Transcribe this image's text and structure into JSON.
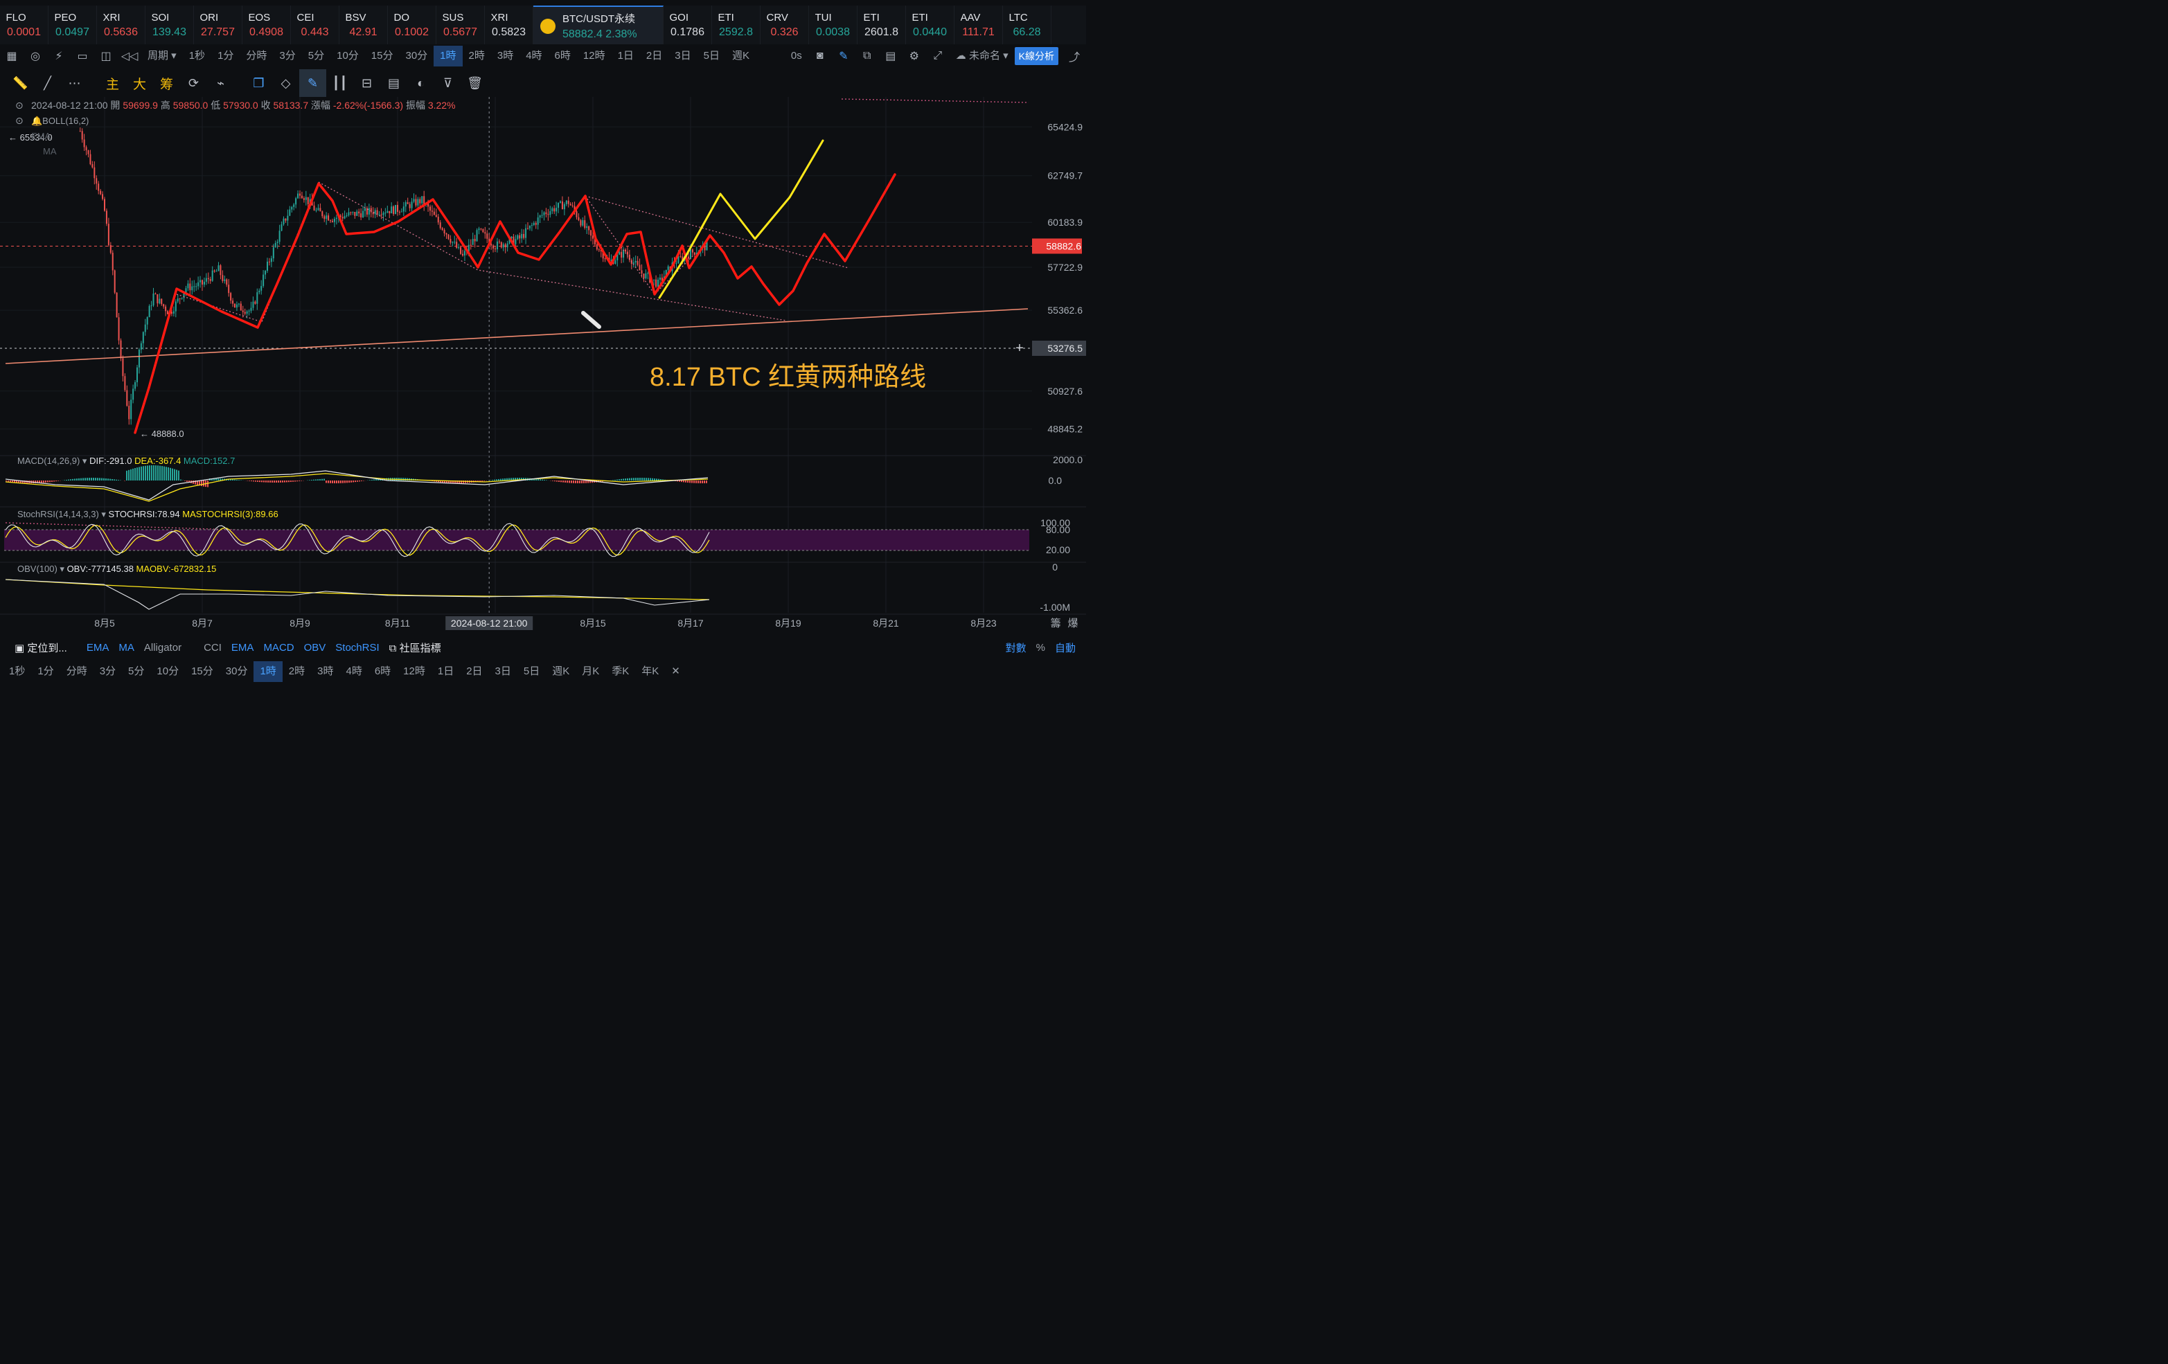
{
  "ticker": [
    {
      "sym": "FLO",
      "px": "0.0001",
      "dir": "down"
    },
    {
      "sym": "PEO",
      "px": "0.0497",
      "dir": "up"
    },
    {
      "sym": "XRI",
      "px": "0.5636",
      "dir": "down"
    },
    {
      "sym": "SOI",
      "px": "139.43",
      "dir": "up"
    },
    {
      "sym": "ORI",
      "px": "27.757",
      "dir": "down"
    },
    {
      "sym": "EOS",
      "px": "0.4908",
      "dir": "down"
    },
    {
      "sym": "CEI",
      "px": "0.443",
      "dir": "down"
    },
    {
      "sym": "BSV",
      "px": "42.91",
      "dir": "down"
    },
    {
      "sym": "DO",
      "px": "0.1002",
      "dir": "down"
    },
    {
      "sym": "SUS",
      "px": "0.5677",
      "dir": "down"
    },
    {
      "sym": "XRI",
      "px": "0.5823",
      "dir": "neutral"
    },
    {
      "sym": "BTC/USDT永续",
      "px": "58882.4  2.38%",
      "dir": "up",
      "active": true
    },
    {
      "sym": "GOI",
      "px": "0.1786",
      "dir": "neutral"
    },
    {
      "sym": "ETI",
      "px": "2592.8",
      "dir": "up"
    },
    {
      "sym": "CRV",
      "px": "0.326",
      "dir": "down"
    },
    {
      "sym": "TUI",
      "px": "0.0038",
      "dir": "up"
    },
    {
      "sym": "ETI",
      "px": "2601.8",
      "dir": "neutral"
    },
    {
      "sym": "ETI",
      "px": "0.0440",
      "dir": "up"
    },
    {
      "sym": "AAV",
      "px": "111.71",
      "dir": "down"
    },
    {
      "sym": "LTC",
      "px": "66.28",
      "dir": "up"
    }
  ],
  "periods": {
    "label": "周期",
    "items": [
      "1秒",
      "1分",
      "分時",
      "3分",
      "5分",
      "10分",
      "15分",
      "30分",
      "1時",
      "2時",
      "3時",
      "4時",
      "6時",
      "12時",
      "1日",
      "2日",
      "3日",
      "5日",
      "週K"
    ],
    "selected": "1時",
    "seconds": "0s",
    "layout_name": "未命名",
    "analysis_button": "K線分析"
  },
  "tools_cn": [
    "主",
    "大",
    "筹"
  ],
  "colors": {
    "up": "#26a69a",
    "down": "#ef5350",
    "neutral": "#d9dce1",
    "yellow": "#ffe81a",
    "red": "#ff1a12",
    "accent": "#2f7de1",
    "trend": "#f08a70",
    "orange_text": "#f5b02e"
  },
  "chart_data": {
    "type": "candlestick",
    "symbol": "BTC/USDT永续",
    "interval": "1時",
    "ohlc_header": {
      "time": "2024-08-12 21:00",
      "open_label": "開",
      "open": "59699.9",
      "high_label": "高",
      "high": "59850.0",
      "low_label": "低",
      "low": "57930.0",
      "close_label": "收",
      "close": "58133.7",
      "change_label": "漲幅",
      "change": "-2.62%(-1566.3)",
      "amp_label": "振幅",
      "amp": "3.22%"
    },
    "overlays": [
      "BOLL(16,2)",
      "EMA",
      "MA"
    ],
    "y_ticks": [
      "65424.9",
      "62749.7",
      "60183.9",
      "57722.9",
      "55362.6",
      "50927.6",
      "48845.2"
    ],
    "y_range": [
      47500,
      66500
    ],
    "last_price": "58882.6",
    "crosshair_price": "53276.5",
    "crosshair_time": "2024-08-12 21:00",
    "high_marker": "65534.0",
    "low_marker": "48888.0",
    "x_ticks": [
      "8月5",
      "8月7",
      "8月9",
      "8月11",
      "8月15",
      "8月17",
      "8月19",
      "8月21",
      "8月23"
    ],
    "annotation": "8.17  BTC 红黄两种路线",
    "price_path": [
      [
        "08-04 12:00",
        65200
      ],
      [
        "08-04 20:00",
        62500
      ],
      [
        "08-05 00:00",
        60800
      ],
      [
        "08-05 04:00",
        57500
      ],
      [
        "08-05 08:00",
        52500
      ],
      [
        "08-05 12:00",
        49500
      ],
      [
        "08-05 18:00",
        53800
      ],
      [
        "08-06 00:00",
        56200
      ],
      [
        "08-06 08:00",
        55200
      ],
      [
        "08-06 16:00",
        56600
      ],
      [
        "08-07 00:00",
        56800
      ],
      [
        "08-07 08:00",
        57600
      ],
      [
        "08-07 16:00",
        55600
      ],
      [
        "08-08 00:00",
        55300
      ],
      [
        "08-08 08:00",
        57800
      ],
      [
        "08-08 16:00",
        60200
      ],
      [
        "08-09 00:00",
        61900
      ],
      [
        "08-09 08:00",
        60800
      ],
      [
        "08-09 16:00",
        60400
      ],
      [
        "08-10 00:00",
        60600
      ],
      [
        "08-10 12:00",
        60800
      ],
      [
        "08-11 00:00",
        60900
      ],
      [
        "08-11 12:00",
        61400
      ],
      [
        "08-12 00:00",
        59600
      ],
      [
        "08-12 08:00",
        58300
      ],
      [
        "08-12 16:00",
        59700
      ],
      [
        "08-13 00:00",
        58900
      ],
      [
        "08-13 12:00",
        59300
      ],
      [
        "08-14 00:00",
        60700
      ],
      [
        "08-14 12:00",
        61300
      ],
      [
        "08-15 00:00",
        59200
      ],
      [
        "08-15 08:00",
        58000
      ],
      [
        "08-15 16:00",
        58600
      ],
      [
        "08-16 00:00",
        57400
      ],
      [
        "08-16 08:00",
        56800
      ],
      [
        "08-16 16:00",
        58000
      ],
      [
        "08-17 00:00",
        58500
      ],
      [
        "08-17 08:00",
        58900
      ]
    ],
    "macd": {
      "label": "MACD(14,26,9)",
      "dif_label": "DIF:",
      "dif": "-291.0",
      "dea_label": "DEA:",
      "dea": "-367.4",
      "macd_label": "MACD:",
      "macd": "152.7",
      "y_ticks": [
        "2000.0",
        "0.0"
      ]
    },
    "stochrsi": {
      "label": "StochRSI(14,14,3,3)",
      "k_label": "STOCHRSI:",
      "k": "78.94",
      "d_label": "MASTOCHRSI(3):",
      "d": "89.66",
      "y_ticks": [
        "100.00",
        "80.00",
        "20.00"
      ]
    },
    "obv": {
      "label": "OBV(100)",
      "obv_label": "OBV:",
      "obv": "-777145.38",
      "ma_label": "MAOBV:",
      "maobv": "-672832.15",
      "y_ticks": [
        "0",
        "-1.00M"
      ]
    }
  },
  "indicator_bar": {
    "locate": "定位到...",
    "items": [
      "EMA",
      "MA",
      "Alligator",
      "CCI",
      "EMA",
      "MACD",
      "OBV",
      "StochRSI"
    ],
    "active": [
      "EMA",
      "MA",
      "MACD",
      "OBV",
      "StochRSI"
    ],
    "community": "社區指標",
    "right": [
      "對數",
      "%",
      "自動"
    ]
  },
  "bottom_periods": {
    "items": [
      "1秒",
      "1分",
      "分時",
      "3分",
      "5分",
      "10分",
      "15分",
      "30分",
      "1時",
      "2時",
      "3時",
      "4時",
      "6時",
      "12時",
      "1日",
      "2日",
      "3日",
      "5日",
      "週K",
      "月K",
      "季K",
      "年K"
    ],
    "selected": "1時"
  },
  "right_labels": [
    "籌",
    "爆"
  ]
}
